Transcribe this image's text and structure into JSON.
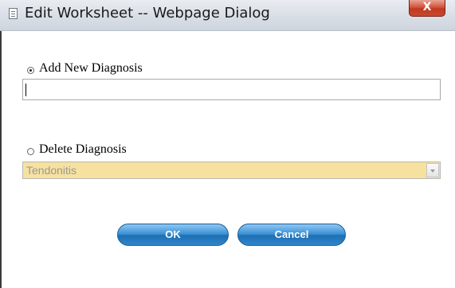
{
  "window": {
    "title": "Edit Worksheet -- Webpage Dialog",
    "close_label": "X"
  },
  "form": {
    "add_option": {
      "label": "Add New Diagnosis",
      "checked": true
    },
    "new_diagnosis_input": {
      "value": ""
    },
    "delete_option": {
      "label": "Delete Diagnosis",
      "checked": false
    },
    "diagnosis_select": {
      "selected": "Tendonitis"
    }
  },
  "buttons": {
    "ok_label": "OK",
    "cancel_label": "Cancel"
  },
  "colors": {
    "select_background": "#f6e19f",
    "button_blue": "#2f86cc",
    "close_red": "#c0391f"
  }
}
